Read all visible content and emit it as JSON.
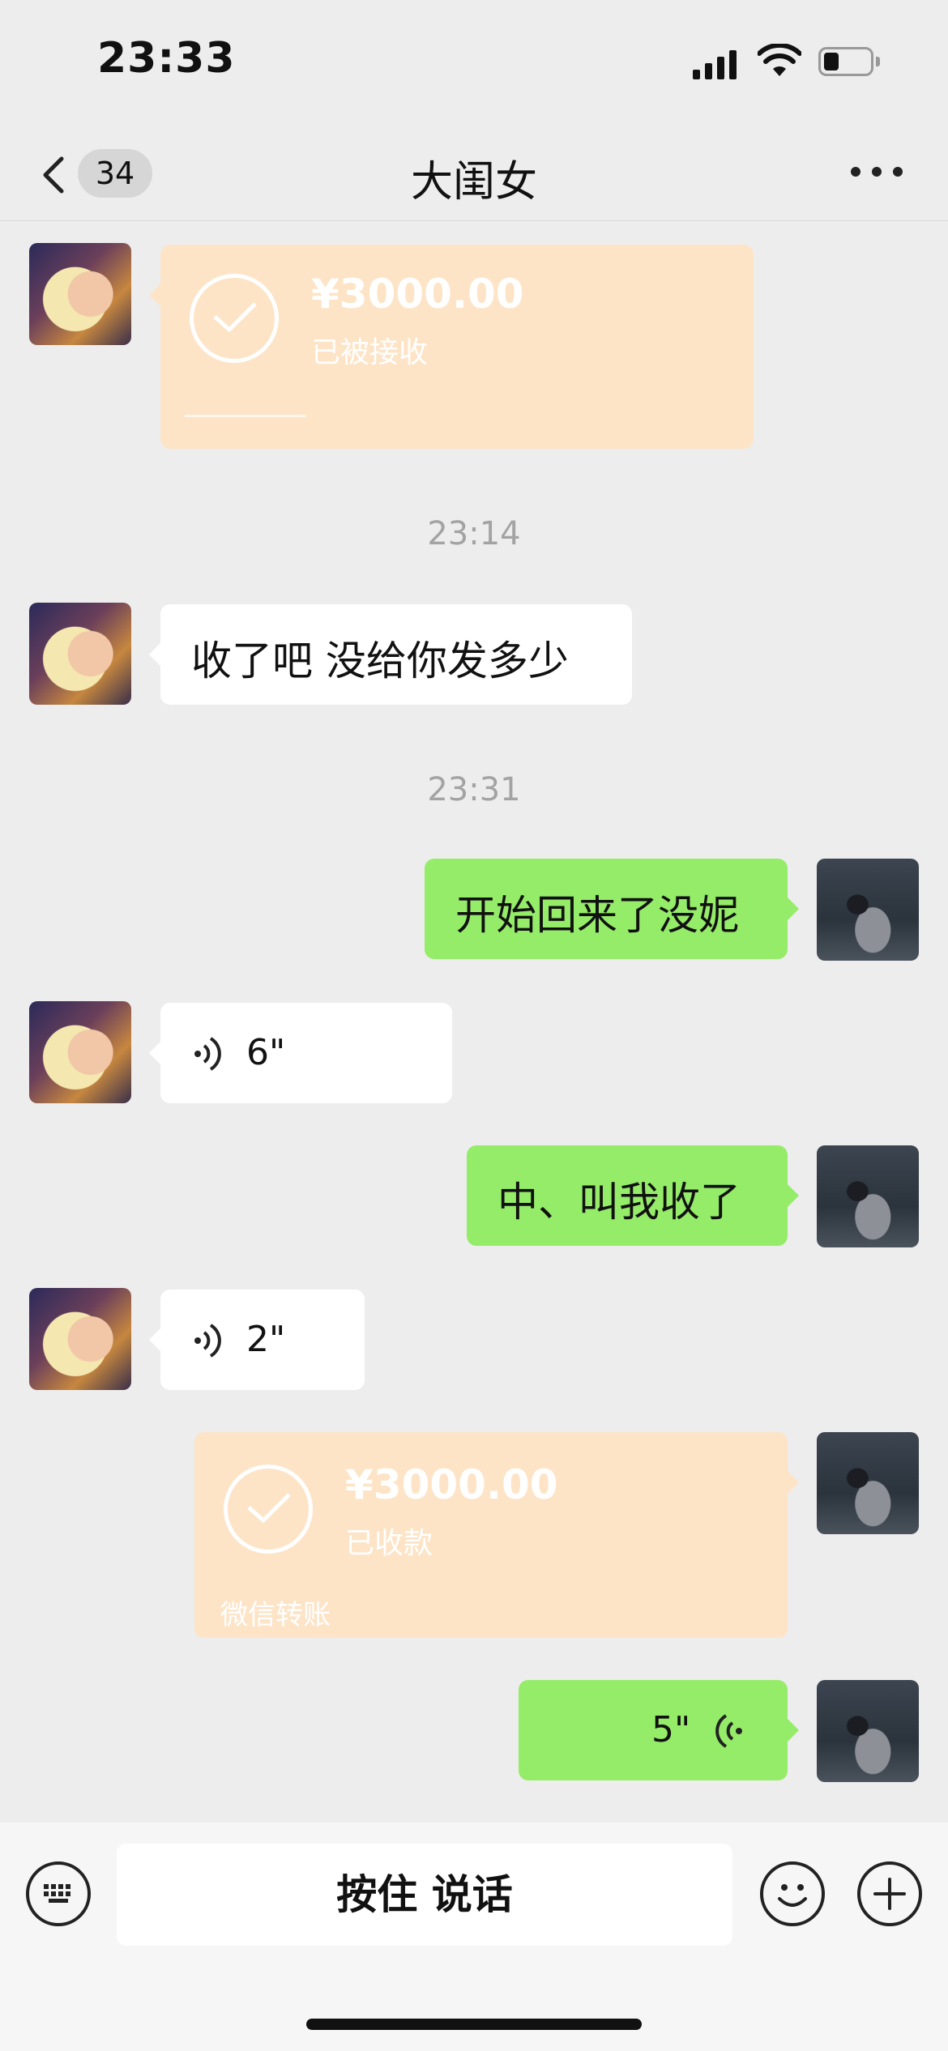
{
  "status_bar": {
    "time": "23:33"
  },
  "header": {
    "unread_count": "34",
    "title": "大闺女"
  },
  "messages": {
    "transfer_received": {
      "amount": "¥3000.00",
      "status": "已被接收"
    },
    "time_1": "23:14",
    "text_1": "收了吧  没给你发多少",
    "time_2": "23:31",
    "text_2": "开始回来了没妮",
    "voice_1": "6\"",
    "text_3": "中、叫我收了",
    "voice_2": "2\"",
    "transfer_sent": {
      "amount": "¥3000.00",
      "status": "已收款",
      "footer": "微信转账"
    },
    "voice_3": "5\""
  },
  "input_bar": {
    "hold_to_talk": "按住 说话"
  },
  "colors": {
    "green_bubble": "#95ec69",
    "transfer": "#fde4c7",
    "background": "#ededed"
  },
  "icons": [
    "keyboard-icon",
    "emoji-icon",
    "plus-icon",
    "voice-wave-icon",
    "check-icon",
    "chevron-left-icon",
    "more-icon"
  ]
}
